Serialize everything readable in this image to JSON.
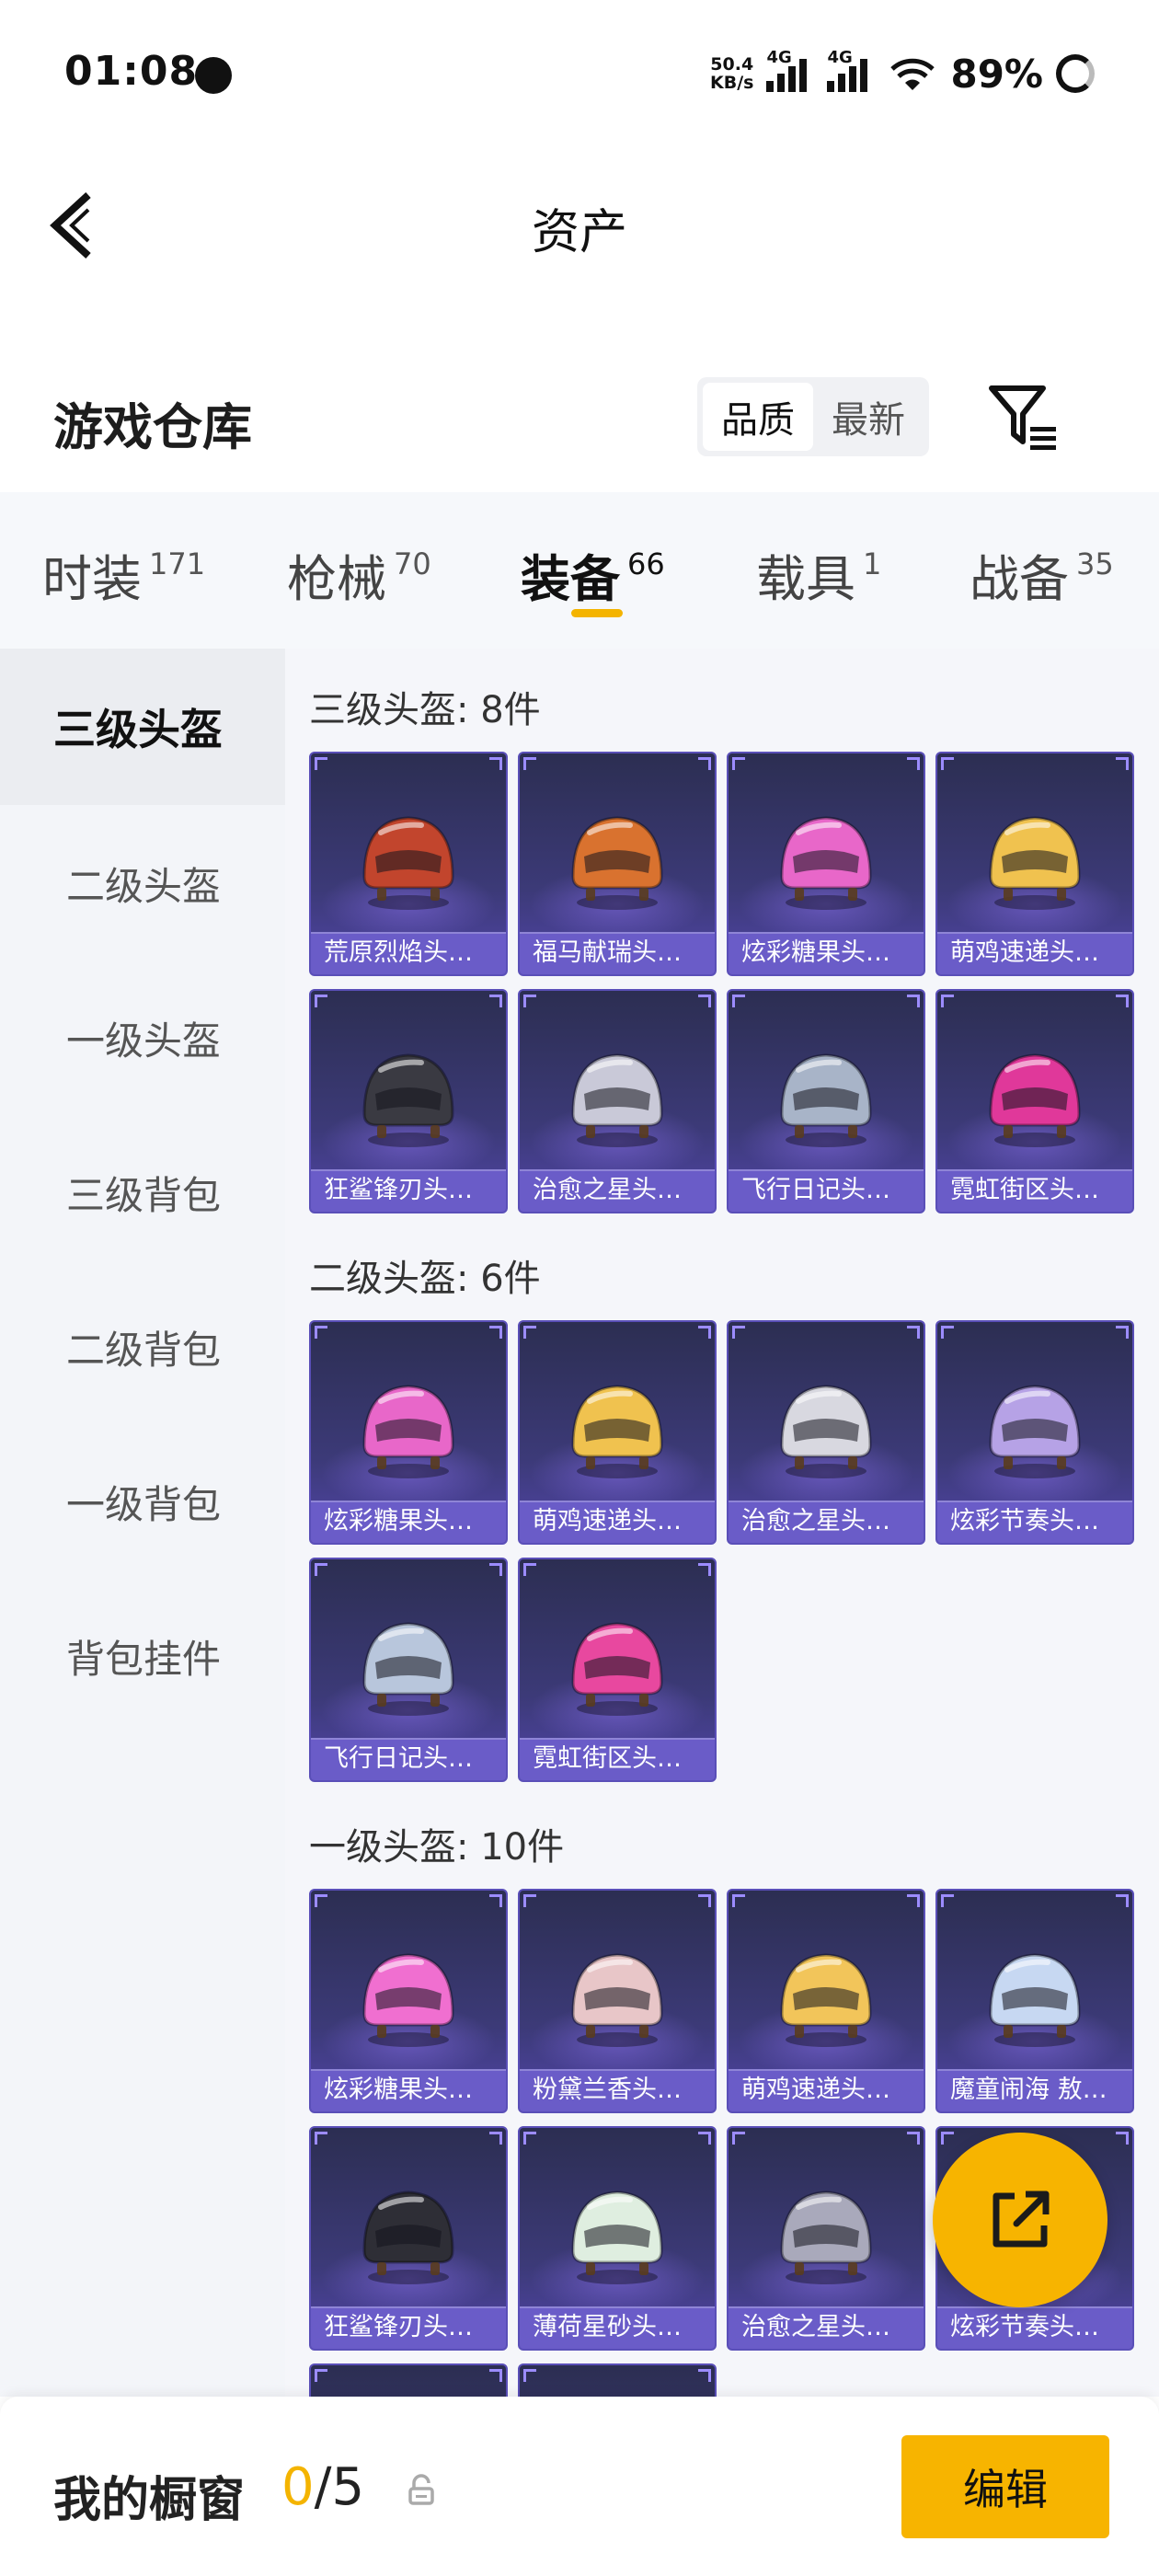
{
  "status_bar": {
    "time": "01:08",
    "net_speed_value": "50.4",
    "net_speed_unit": "KB/s",
    "net1": "4G",
    "net2": "4G",
    "battery": "89%"
  },
  "header": {
    "title": "资产"
  },
  "warehouse": {
    "title": "游戏仓库",
    "sort_options": [
      "品质",
      "最新"
    ],
    "active_sort": "品质"
  },
  "tabs": [
    {
      "label": "时装",
      "count": "171"
    },
    {
      "label": "枪械",
      "count": "70"
    },
    {
      "label": "装备",
      "count": "66",
      "active": true
    },
    {
      "label": "载具",
      "count": "1"
    },
    {
      "label": "战备",
      "count": "35"
    }
  ],
  "sidebar": {
    "items": [
      "三级头盔",
      "二级头盔",
      "一级头盔",
      "三级背包",
      "二级背包",
      "一级背包",
      "背包挂件"
    ],
    "active_index": 0
  },
  "sections": [
    {
      "title": "三级头盔: 8件",
      "items": [
        {
          "name": "荒原烈焰头…",
          "icon": "flame-wolf-helmet-icon",
          "color": "#c2452d"
        },
        {
          "name": "福马献瑞头…",
          "icon": "horse-helmet-icon",
          "color": "#d9722f"
        },
        {
          "name": "炫彩糖果头…",
          "icon": "candy-helmet-icon",
          "color": "#e867c9"
        },
        {
          "name": "萌鸡速递头…",
          "icon": "chick-helmet-icon",
          "color": "#f0c24f"
        },
        {
          "name": "狂鲨锋刃头…",
          "icon": "shark-helmet-icon",
          "color": "#3a3a42"
        },
        {
          "name": "治愈之星头…",
          "icon": "star-helmet-icon",
          "color": "#c9c9d8"
        },
        {
          "name": "飞行日记头…",
          "icon": "pilot-helmet-icon",
          "color": "#a8b4c8"
        },
        {
          "name": "霓虹街区头…",
          "icon": "neon-helmet-icon",
          "color": "#e0389a"
        }
      ]
    },
    {
      "title": "二级头盔: 6件",
      "items": [
        {
          "name": "炫彩糖果头…",
          "icon": "candy-helmet-icon",
          "color": "#e867c9"
        },
        {
          "name": "萌鸡速递头…",
          "icon": "chick-helmet-icon",
          "color": "#f0c24f"
        },
        {
          "name": "治愈之星头…",
          "icon": "star-helmet-icon",
          "color": "#d8d8e0"
        },
        {
          "name": "炫彩节奏头…",
          "icon": "rhythm-helmet-icon",
          "color": "#b6a2e6"
        },
        {
          "name": "飞行日记头…",
          "icon": "pilot-helmet-icon",
          "color": "#b8c6dc"
        },
        {
          "name": "霓虹街区头…",
          "icon": "neon-helmet-icon",
          "color": "#e8489f"
        }
      ]
    },
    {
      "title": "一级头盔: 10件",
      "items": [
        {
          "name": "炫彩糖果头…",
          "icon": "candy-helmet-icon",
          "color": "#f06fd0"
        },
        {
          "name": "粉黛兰香头…",
          "icon": "pink-helmet-icon",
          "color": "#e8c6c8"
        },
        {
          "name": "萌鸡速递头…",
          "icon": "chick-helmet-icon",
          "color": "#f2c55a"
        },
        {
          "name": "魔童闹海 敖…",
          "icon": "dragon-helmet-icon",
          "color": "#c7d8f2"
        },
        {
          "name": "狂鲨锋刃头…",
          "icon": "shark-helmet-icon",
          "color": "#2e2e36"
        },
        {
          "name": "薄荷星砂头…",
          "icon": "mint-helmet-icon",
          "color": "#dfeee0"
        },
        {
          "name": "治愈之星头…",
          "icon": "star-helmet-icon",
          "color": "#a9a9bb"
        },
        {
          "name": "炫彩节奏头…",
          "icon": "rhythm-helmet-icon",
          "color": "#b6a2e6"
        },
        {
          "name": "",
          "icon": "helmet-icon",
          "color": "#3b3b4a"
        },
        {
          "name": "",
          "icon": "helmet-icon",
          "color": "#3b3b4a"
        }
      ]
    }
  ],
  "showcase": {
    "title": "我的橱窗",
    "current": "0",
    "max": "/5",
    "edit_label": "编辑"
  },
  "colors": {
    "accent": "#f7b400",
    "card_top": "#2c2e52",
    "card_label": "#6a5cc8"
  }
}
